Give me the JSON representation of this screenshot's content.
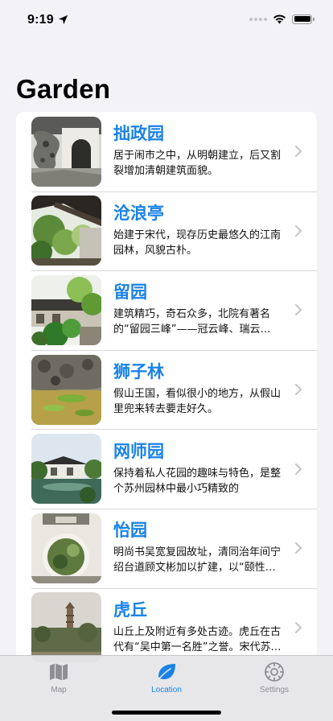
{
  "status_bar": {
    "time": "9:19",
    "location_icon": "location-arrow-icon",
    "signal_icon": "cellular-dots-icon",
    "wifi_icon": "wifi-icon",
    "battery_icon": "battery-icon",
    "battery_level": 1.0
  },
  "page": {
    "title": "Garden"
  },
  "gardens": [
    {
      "name": "拙政园",
      "desc": "居于闹市之中，从明朝建立，后又割裂增加清朝建筑面貌。"
    },
    {
      "name": "沧浪亭",
      "desc": "始建于宋代，现存历史最悠久的江南园林，风貌古朴。"
    },
    {
      "name": "留园",
      "desc": "建筑精巧，奇石众多，北院有著名的“留园三峰”——冠云峰、瑞云峰、…"
    },
    {
      "name": "狮子林",
      "desc": "假山王国，看似很小的地方，从假山里兜来转去要走好久。"
    },
    {
      "name": "网师园",
      "desc": "保持着私人花园的趣味与特色，是整个苏州园林中最小巧精致的"
    },
    {
      "name": "怡园",
      "desc": "明尚书吴宽复园故址，清同治年间宁绍台道顾文彬加以扩建，以“颐性…"
    },
    {
      "name": "虎丘",
      "desc": "山丘上及附近有多处古迹。虎丘在古代有“吴中第一名胜”之誉。宋代苏…"
    }
  ],
  "tab_bar": {
    "tabs": [
      {
        "label": "Map",
        "icon": "map-icon",
        "active": false
      },
      {
        "label": "Location",
        "icon": "leaf-icon",
        "active": true
      },
      {
        "label": "Settings",
        "icon": "gear-icon",
        "active": false
      }
    ]
  },
  "colors": {
    "accent": "#1a82e8",
    "background": "#f2f2f7",
    "tab_inactive": "#8e8e93"
  }
}
